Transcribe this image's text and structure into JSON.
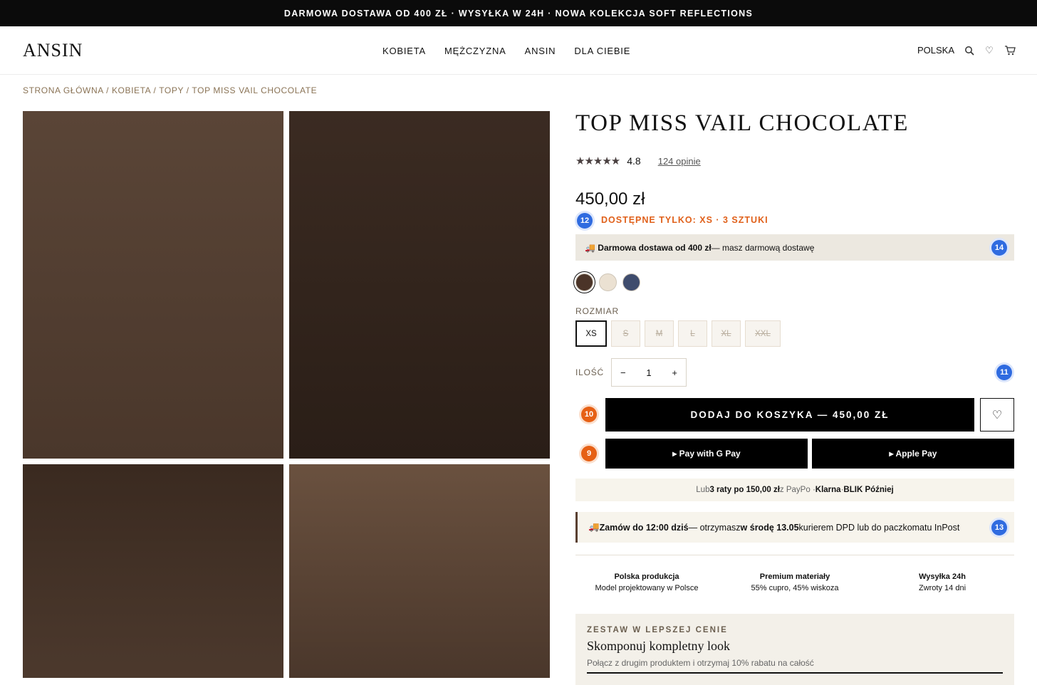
{
  "promo": "DARMOWA DOSTAWA OD 400 ZŁ · WYSYŁKA W 24H · NOWA KOLEKCJA SOFT REFLECTIONS",
  "header": {
    "logo": "ANSIN",
    "nav": [
      "KOBIETA",
      "MĘŻCZYZNA",
      "ANSIN",
      "DLA CIEBIE"
    ],
    "country": "POLSKA",
    "icons": [
      "search-icon",
      "heart-icon",
      "cart-icon"
    ]
  },
  "breadcrumb": "STRONA GŁÓWNA / KOBIETA / TOPY / TOP MISS VAIL CHOCOLATE",
  "product": {
    "title": "TOP MISS VAIL CHOCOLATE",
    "stars": "★★★★★",
    "rating": "4.8",
    "reviews": "124 opinie",
    "price": "450,00 zł",
    "stock": "DOSTĘPNE TYLKO: XS · 3 SZTUKI",
    "shipping_bold": "🚚 Darmowa dostawa od 400 zł",
    "shipping_rest": " — masz darmową dostawę",
    "colors": [
      "#4b3428",
      "#ebe1d2",
      "#3f4c6d"
    ],
    "size_label": "ROZMIAR",
    "sizes": [
      "XS",
      "S",
      "M",
      "L",
      "XL",
      "XXL"
    ],
    "qty_label": "ILOŚĆ",
    "qty_minus": "−",
    "qty_value": "1",
    "qty_plus": "+",
    "add_to_cart": "DODAJ DO KOSZYKA — 450,00 ZŁ",
    "wishlist_glyph": "♡",
    "gpay": "▸ Pay with G Pay",
    "applepay": "▸ Apple Pay",
    "installments": {
      "pre": "Lub ",
      "bold": "3 raty po 150,00 zł",
      "mid": " z PayPo · ",
      "klarna": "Klarna",
      "sep": " · ",
      "blik": "BLIK Później"
    },
    "delivery": {
      "icon": "🚚 ",
      "bold1": "Zamów do 12:00 dziś",
      "mid": " — otrzymasz ",
      "bold2": "w środę 13.05",
      "rest": " kurierem DPD lub do paczkomatu InPost"
    },
    "features": [
      {
        "title": "Polska produkcja",
        "sub": "Model projektowany w Polsce"
      },
      {
        "title": "Premium materiały",
        "sub": "55% cupro, 45% wiskoza"
      },
      {
        "title": "Wysyłka 24h",
        "sub": "Zwroty 14 dni"
      }
    ],
    "bundle": {
      "kicker": "ZESTAW W LEPSZEJ CENIE",
      "title": "Skomponuj kompletny look",
      "sub": "Połącz z drugim produktem i otrzymaj 10% rabatu na całość"
    }
  },
  "annotations": [
    "12",
    "14",
    "11",
    "10",
    "9",
    "13"
  ]
}
